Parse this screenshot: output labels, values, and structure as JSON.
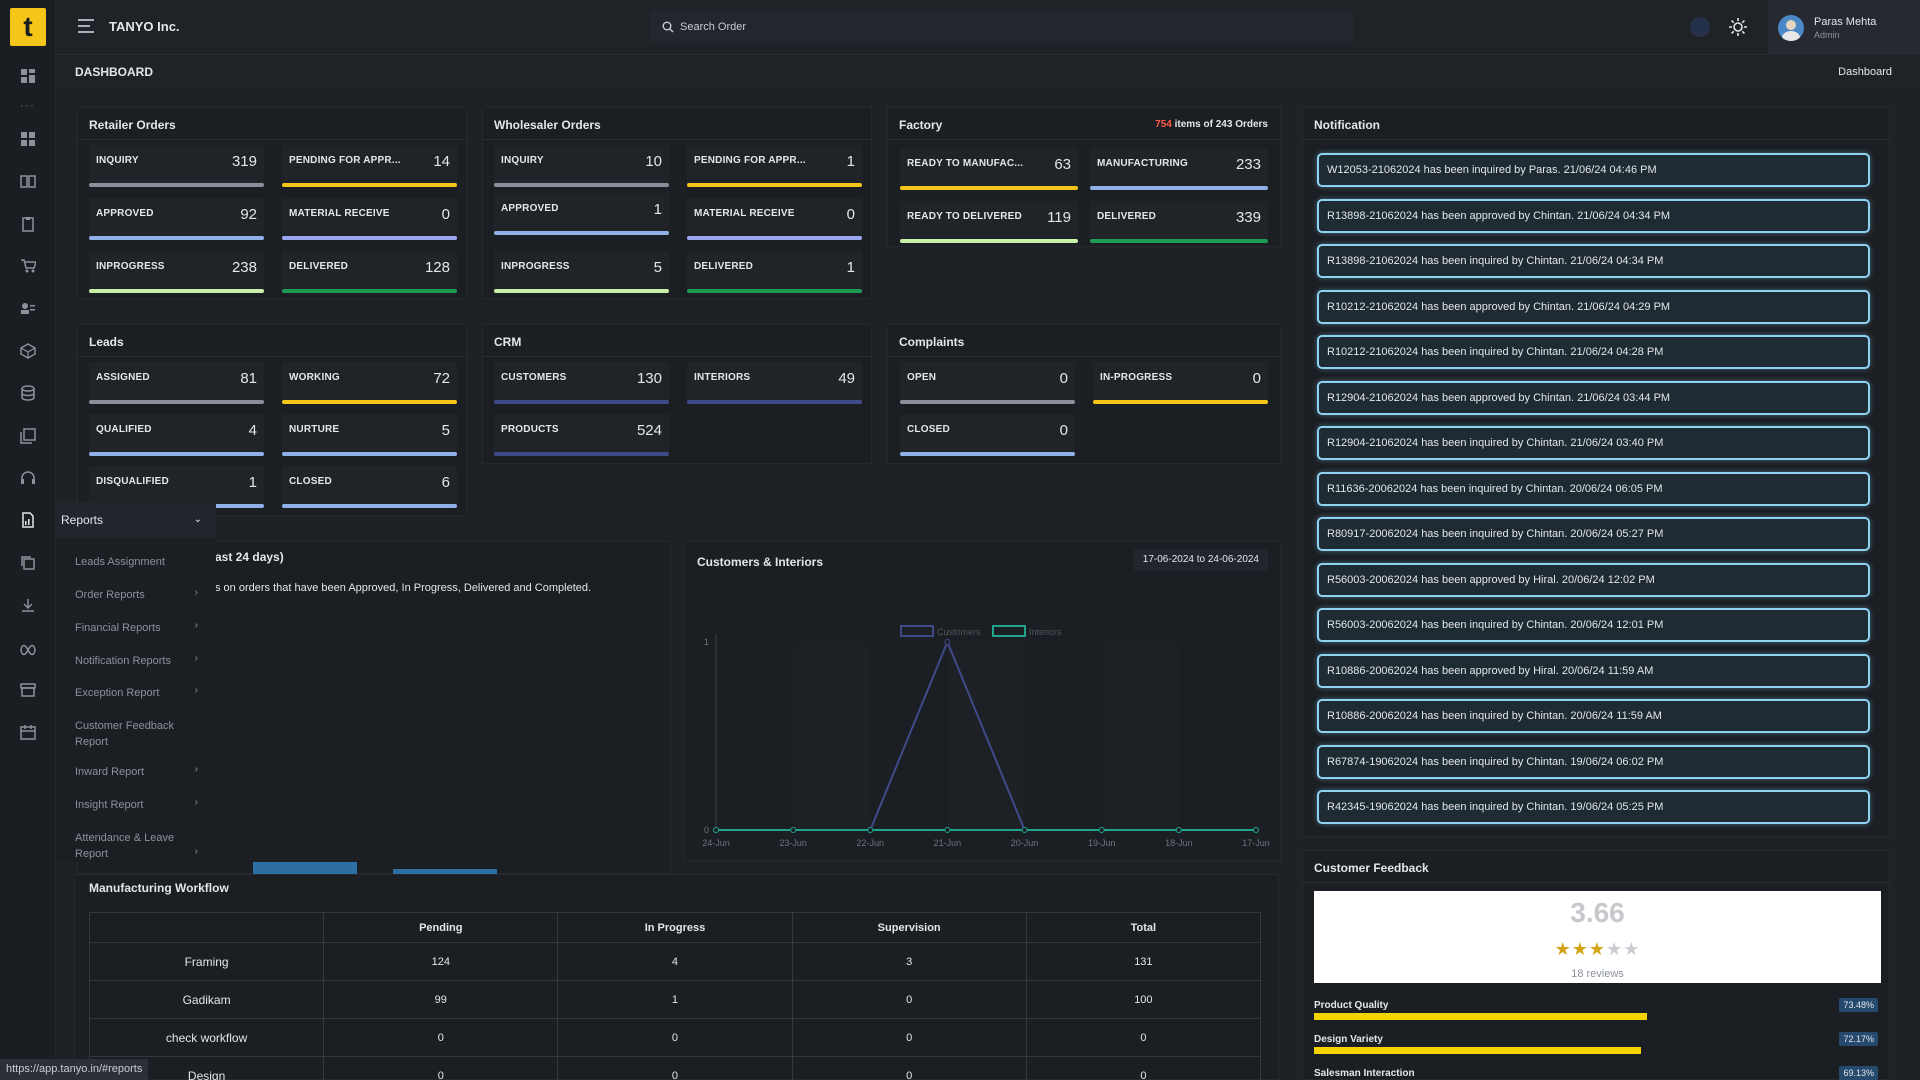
{
  "header": {
    "company": "TANYO Inc.",
    "search_placeholder": "Search Order",
    "user_name": "Paras Mehta",
    "user_role": "Admin"
  },
  "page": {
    "title": "DASHBOARD",
    "breadcrumb": "Dashboard"
  },
  "retailer": {
    "title": "Retailer Orders",
    "stats": [
      {
        "label": "INQUIRY",
        "value": "319"
      },
      {
        "label": "PENDING FOR APPR...",
        "value": "14"
      },
      {
        "label": "APPROVED",
        "value": "92"
      },
      {
        "label": "MATERIAL RECEIVE",
        "value": "0"
      },
      {
        "label": "INPROGRESS",
        "value": "238"
      },
      {
        "label": "DELIVERED",
        "value": "128"
      }
    ]
  },
  "wholesaler": {
    "title": "Wholesaler Orders",
    "stats": [
      {
        "label": "INQUIRY",
        "value": "10"
      },
      {
        "label": "PENDING FOR APPR...",
        "value": "1"
      },
      {
        "label": "APPROVED",
        "value": "1"
      },
      {
        "label": "MATERIAL RECEIVE",
        "value": "0"
      },
      {
        "label": "INPROGRESS",
        "value": "5"
      },
      {
        "label": "DELIVERED",
        "value": "1"
      }
    ]
  },
  "factory": {
    "title": "Factory",
    "items_count": "754",
    "items_text": " items of ",
    "orders_count": "243",
    "orders_text": " Orders",
    "stats": [
      {
        "label": "READY TO MANUFAC...",
        "value": "63"
      },
      {
        "label": "MANUFACTURING",
        "value": "233"
      },
      {
        "label": "READY TO DELIVERED",
        "value": "119"
      },
      {
        "label": "DELIVERED",
        "value": "339"
      }
    ]
  },
  "leads": {
    "title": "Leads",
    "stats": [
      {
        "label": "ASSIGNED",
        "value": "81"
      },
      {
        "label": "WORKING",
        "value": "72"
      },
      {
        "label": "QUALIFIED",
        "value": "4"
      },
      {
        "label": "NURTURE",
        "value": "5"
      },
      {
        "label": "DISQUALIFIED",
        "value": "1"
      },
      {
        "label": "CLOSED",
        "value": "6"
      }
    ]
  },
  "crm": {
    "title": "CRM",
    "stats": [
      {
        "label": "CUSTOMERS",
        "value": "130"
      },
      {
        "label": "INTERIORS",
        "value": "49"
      },
      {
        "label": "PRODUCTS",
        "value": "524"
      }
    ]
  },
  "complaints": {
    "title": "Complaints",
    "stats": [
      {
        "label": "OPEN",
        "value": "0"
      },
      {
        "label": "IN-PROGRESS",
        "value": "0"
      },
      {
        "label": "CLOSED",
        "value": "0"
      }
    ]
  },
  "reports_menu": {
    "label": "Reports",
    "items": [
      {
        "label": "Leads Assignment",
        "has_sub": false
      },
      {
        "label": "Order Reports",
        "has_sub": true
      },
      {
        "label": "Financial Reports",
        "has_sub": true
      },
      {
        "label": "Notification Reports",
        "has_sub": true
      },
      {
        "label": "Exception Report",
        "has_sub": true
      },
      {
        "label": "Customer Feedback Report",
        "has_sub": false
      },
      {
        "label": "Inward Report",
        "has_sub": true
      },
      {
        "label": "Insight Report",
        "has_sub": true
      },
      {
        "label": "Attendance & Leave Report",
        "has_sub": true
      }
    ]
  },
  "orders_chart": {
    "title_partial": "ast 24 days)",
    "desc_partial": "s on orders that have been Approved, In Progress, Delivered and Completed."
  },
  "ci_chart": {
    "title": "Customers & Interiors",
    "date_range": "17-06-2024 to 24-06-2024"
  },
  "chart_data": {
    "type": "line",
    "categories": [
      "24-Jun",
      "23-Jun",
      "22-Jun",
      "21-Jun",
      "20-Jun",
      "19-Jun",
      "18-Jun",
      "17-Jun"
    ],
    "series": [
      {
        "name": "Customers",
        "values": [
          0,
          0,
          0,
          1,
          0,
          0,
          0,
          0
        ],
        "color": "#3f4a8a"
      },
      {
        "name": "Interiors",
        "values": [
          0,
          0,
          0,
          0,
          0,
          0,
          0,
          0
        ],
        "color": "#1fa38a"
      }
    ],
    "title": "Customers & Interiors",
    "ylim": [
      0,
      1
    ],
    "yticks": [
      "0",
      "1"
    ],
    "legend": "top"
  },
  "notification": {
    "title": "Notification",
    "items": [
      "W12053-21062024 has been inquired by Paras. 21/06/24 04:46 PM",
      "R13898-21062024 has been approved by Chintan. 21/06/24 04:34 PM",
      "R13898-21062024 has been inquired by Chintan. 21/06/24 04:34 PM",
      "R10212-21062024 has been approved by Chintan. 21/06/24 04:29 PM",
      "R10212-21062024 has been inquired by Chintan. 21/06/24 04:28 PM",
      "R12904-21062024 has been approved by Chintan. 21/06/24 03:44 PM",
      "R12904-21062024 has been inquired by Chintan. 21/06/24 03:40 PM",
      "R11636-20062024 has been inquired by Chintan. 20/06/24 06:05 PM",
      "R80917-20062024 has been inquired by Chintan. 20/06/24 05:27 PM",
      "R56003-20062024 has been approved by Hiral. 20/06/24 12:02 PM",
      "R56003-20062024 has been inquired by Chintan. 20/06/24 12:01 PM",
      "R10886-20062024 has been approved by Hiral. 20/06/24 11:59 AM",
      "R10886-20062024 has been inquired by Chintan. 20/06/24 11:59 AM",
      "R67874-19062024 has been inquired by Chintan. 19/06/24 06:02 PM",
      "R42345-19062024 has been inquired by Chintan. 19/06/24 05:25 PM"
    ]
  },
  "feedback": {
    "title": "Customer Feedback",
    "rating": "3.66",
    "stars_filled": 3,
    "stars_total": 5,
    "reviews": "18 reviews",
    "metrics": [
      {
        "label": "Product Quality",
        "percent": "73.48%",
        "value": 73.48
      },
      {
        "label": "Design Variety",
        "percent": "72.17%",
        "value": 72.17
      },
      {
        "label": "Salesman Interaction",
        "percent": "69.13%",
        "value": 69.13
      }
    ]
  },
  "workflow": {
    "title": "Manufacturing Workflow",
    "columns": [
      "",
      "Pending",
      "In Progress",
      "Supervision",
      "Total"
    ],
    "rows": [
      [
        "Framing",
        "124",
        "4",
        "3",
        "131"
      ],
      [
        "Gadikam",
        "99",
        "1",
        "0",
        "100"
      ],
      [
        "check workflow",
        "0",
        "0",
        "0",
        "0"
      ],
      [
        "Design",
        "0",
        "0",
        "0",
        "0"
      ]
    ]
  },
  "status_url": "https://app.tanyo.in/#reports",
  "colors": {
    "accent_yellow": "#f5c518",
    "notif_border": "#8fd2f2",
    "factory_red": "#ff5a4a"
  }
}
